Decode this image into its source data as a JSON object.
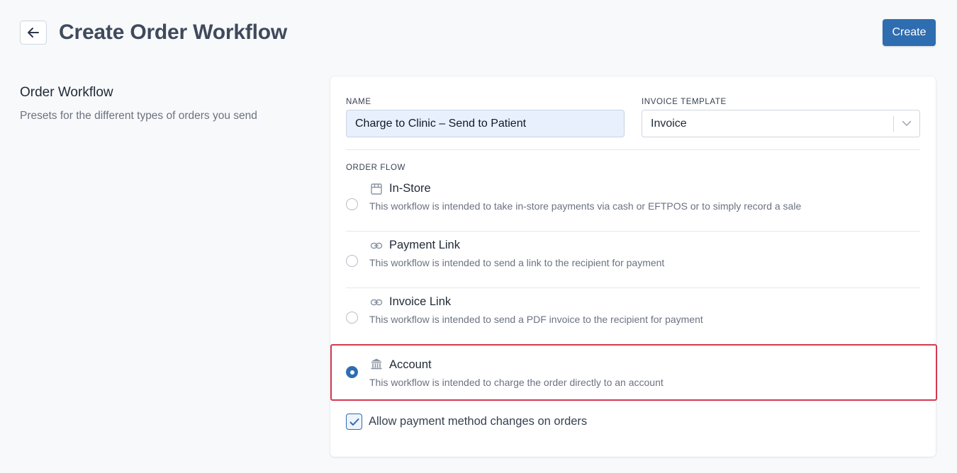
{
  "header": {
    "back_icon": "arrow-left-icon",
    "title": "Create Order Workflow",
    "create_label": "Create"
  },
  "section": {
    "title": "Order Workflow",
    "description": "Presets for the different types of orders you send"
  },
  "form": {
    "name_label": "NAME",
    "name_value": "Charge to Clinic – Send to Patient",
    "invoice_template_label": "INVOICE TEMPLATE",
    "invoice_template_value": "Invoice",
    "order_flow_label": "ORDER FLOW",
    "options": [
      {
        "title": "In-Store",
        "icon": "store-icon",
        "description": "This workflow is intended to take in-store payments via cash or EFTPOS or to simply record a sale",
        "selected": false
      },
      {
        "title": "Payment Link",
        "icon": "link-icon",
        "description": "This workflow is intended to send a link to the recipient for payment",
        "selected": false
      },
      {
        "title": "Invoice Link",
        "icon": "link-icon",
        "description": "This workflow is intended to send a PDF invoice to the recipient for payment",
        "selected": false
      },
      {
        "title": "Account",
        "icon": "bank-icon",
        "description": "This workflow is intended to charge the order directly to an account",
        "selected": true
      }
    ],
    "allow_changes_label": "Allow payment method changes on orders",
    "allow_changes_checked": true
  },
  "colors": {
    "primary": "#2f6db1",
    "highlight_border": "#d33a4f",
    "background": "#f8f9fb"
  }
}
